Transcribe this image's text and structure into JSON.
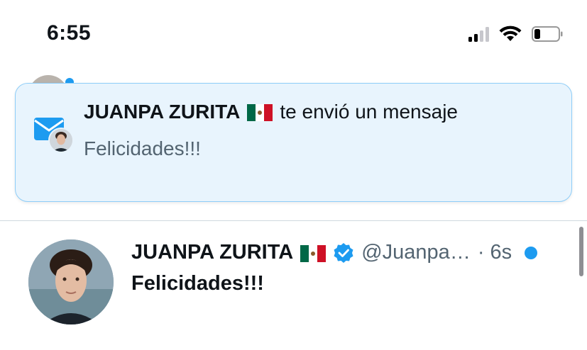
{
  "status_bar": {
    "time": "6:55",
    "signal_bars_active": 2,
    "signal_bars_total": 4,
    "battery_level": 0.2
  },
  "notification": {
    "sender_name": "JUANPA ZURITA",
    "action_text": "te envió un mensaje",
    "message": "Felicidades!!!"
  },
  "conversation": {
    "name": "JUANPA ZURITA",
    "handle": "@Juanpa…",
    "time_ago": "· 6s",
    "message": "Felicidades!!!",
    "unread": true
  },
  "colors": {
    "accent": "#1d9bf0",
    "banner_bg": "#e8f4fd",
    "muted_text": "#536471"
  }
}
